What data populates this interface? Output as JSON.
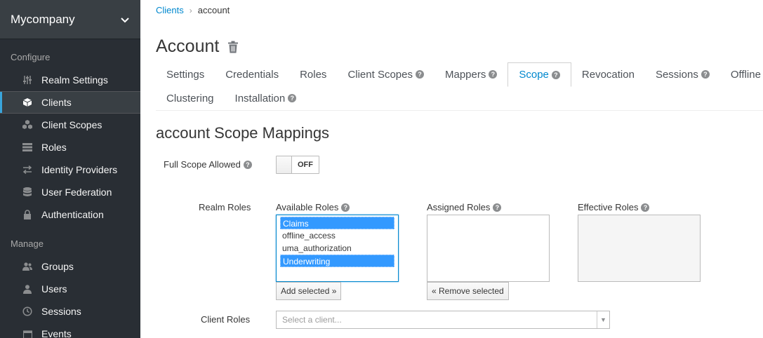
{
  "sidebar": {
    "realm_name": "Mycompany",
    "configure_title": "Configure",
    "manage_title": "Manage",
    "configure_items": [
      {
        "label": "Realm Settings",
        "icon": "sliders-icon"
      },
      {
        "label": "Clients",
        "icon": "cube-icon"
      },
      {
        "label": "Client Scopes",
        "icon": "cubes-icon"
      },
      {
        "label": "Roles",
        "icon": "list-icon"
      },
      {
        "label": "Identity Providers",
        "icon": "exchange-icon"
      },
      {
        "label": "User Federation",
        "icon": "database-icon"
      },
      {
        "label": "Authentication",
        "icon": "lock-icon"
      }
    ],
    "manage_items": [
      {
        "label": "Groups",
        "icon": "users-icon"
      },
      {
        "label": "Users",
        "icon": "user-icon"
      },
      {
        "label": "Sessions",
        "icon": "clock-icon"
      },
      {
        "label": "Events",
        "icon": "calendar-icon"
      }
    ],
    "active": "Clients"
  },
  "breadcrumb": {
    "parent": "Clients",
    "current": "account"
  },
  "page": {
    "title": "Account"
  },
  "tabs": {
    "row1": [
      "Settings",
      "Credentials",
      "Roles",
      "Client Scopes",
      "Mappers",
      "Scope",
      "Revocation",
      "Sessions",
      "Offline Access"
    ],
    "row2": [
      "Clustering",
      "Installation"
    ],
    "active": "Scope"
  },
  "scope": {
    "heading": "account Scope Mappings",
    "full_scope_label": "Full Scope Allowed",
    "toggle_state": "OFF",
    "realm_roles_label": "Realm Roles",
    "available_label": "Available Roles",
    "assigned_label": "Assigned Roles",
    "effective_label": "Effective Roles",
    "available_roles": [
      "Claims",
      "offline_access",
      "uma_authorization",
      "Underwriting"
    ],
    "add_selected": "Add selected »",
    "remove_selected": "« Remove selected",
    "client_roles_label": "Client Roles",
    "client_select_placeholder": "Select a client..."
  },
  "colors": {
    "sidebar_bg": "#292e34",
    "accent": "#0088ce",
    "selection": "#3399ff"
  }
}
